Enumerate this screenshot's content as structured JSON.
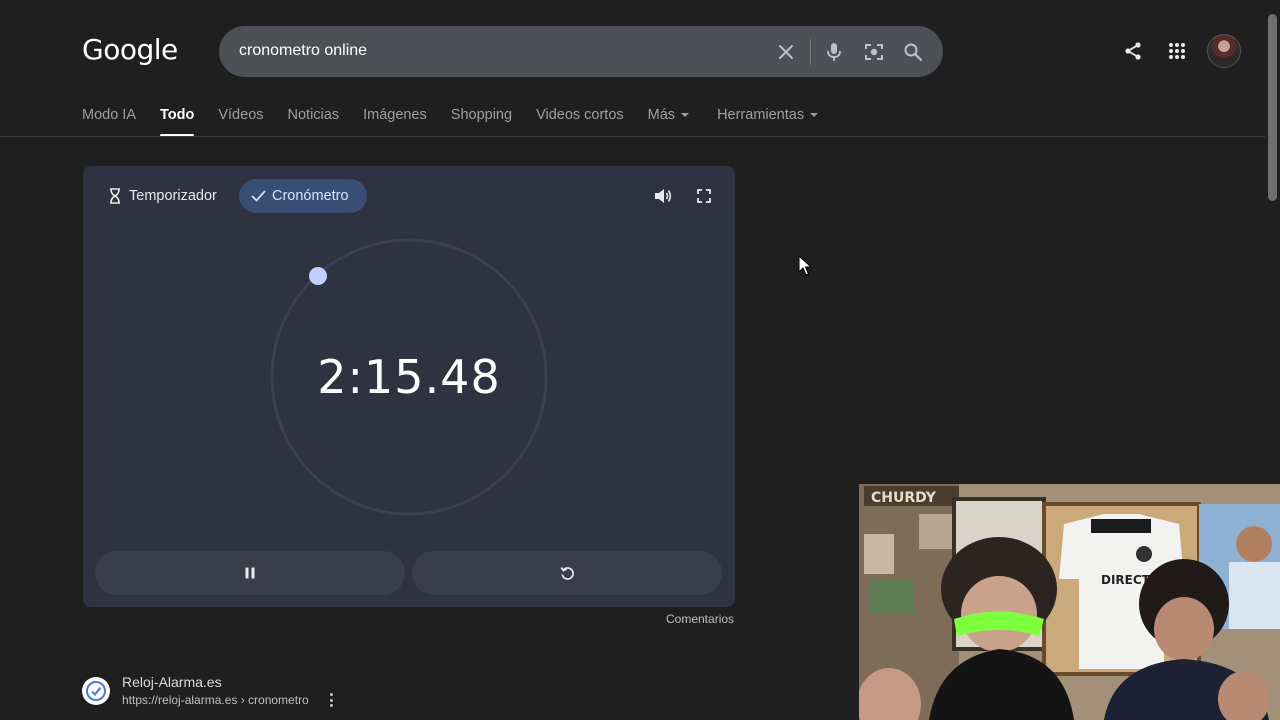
{
  "header": {
    "logo": "Google",
    "search_query": "cronometro online",
    "icons": [
      "close-icon",
      "mic-icon",
      "lens-icon",
      "search-icon",
      "share-icon",
      "apps-icon"
    ]
  },
  "tabs": [
    {
      "label": "Modo IA",
      "active": false
    },
    {
      "label": "Todo",
      "active": true
    },
    {
      "label": "Vídeos",
      "active": false
    },
    {
      "label": "Noticias",
      "active": false
    },
    {
      "label": "Imágenes",
      "active": false
    },
    {
      "label": "Shopping",
      "active": false
    },
    {
      "label": "Videos cortos",
      "active": false
    },
    {
      "label": "Más",
      "active": false,
      "dropdown": true
    },
    {
      "label": "Herramientas",
      "active": false,
      "dropdown": true
    }
  ],
  "stopwatch": {
    "timer_label": "Temporizador",
    "stopwatch_label": "Cronómetro",
    "selected_mode": "stopwatch",
    "time": "2:15.48",
    "controls": [
      "pause-icon",
      "reset-icon"
    ],
    "accent_color": "#c2d0ff",
    "selected_chip_color": "#394e75"
  },
  "feedback_label": "Comentarios",
  "result": {
    "site_name": "Reloj-Alarma.es",
    "url": "https://reloj-alarma.es › cronometro"
  },
  "webcam_overlay": {
    "banner_text": "CHURDY",
    "jersey_text": "DIRECTV"
  }
}
